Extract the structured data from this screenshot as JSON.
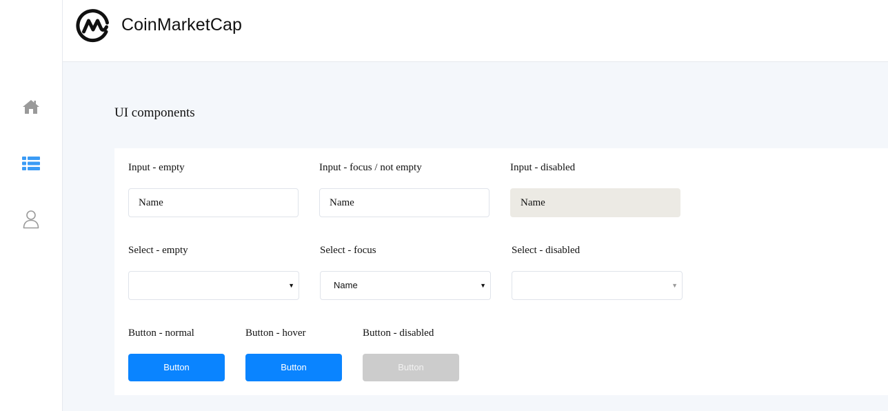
{
  "brand": {
    "name": "CoinMarketCap",
    "color": "#111111"
  },
  "sidebar": {
    "items": [
      {
        "icon": "home-icon",
        "active": false,
        "color": "#9a9a9a"
      },
      {
        "icon": "list-icon",
        "active": true,
        "color": "#3b9bf5"
      },
      {
        "icon": "user-icon",
        "active": false,
        "color": "#9a9a9a"
      }
    ]
  },
  "main": {
    "title": "UI components",
    "inputs": {
      "empty": {
        "label": "Input - empty",
        "placeholder": "Name"
      },
      "focus": {
        "label": "Input - focus / not empty",
        "value": "Name"
      },
      "disabled": {
        "label": "Input - disabled",
        "value": "Name"
      }
    },
    "selects": {
      "empty": {
        "label": "Select - empty",
        "value": ""
      },
      "focus": {
        "label": "Select - focus",
        "value": "Name"
      },
      "disabled": {
        "label": "Select - disabled",
        "value": ""
      }
    },
    "buttons": {
      "normal": {
        "label": "Button - normal",
        "text": "Button"
      },
      "hover": {
        "label": "Button - hover",
        "text": "Button"
      },
      "disabled": {
        "label": "Button - disabled",
        "text": "Button"
      }
    },
    "colors": {
      "primary": "#0a84ff",
      "disabled_button": "#cccccc",
      "disabled_input": "#eceae4",
      "background": "#f4f7fb"
    }
  }
}
